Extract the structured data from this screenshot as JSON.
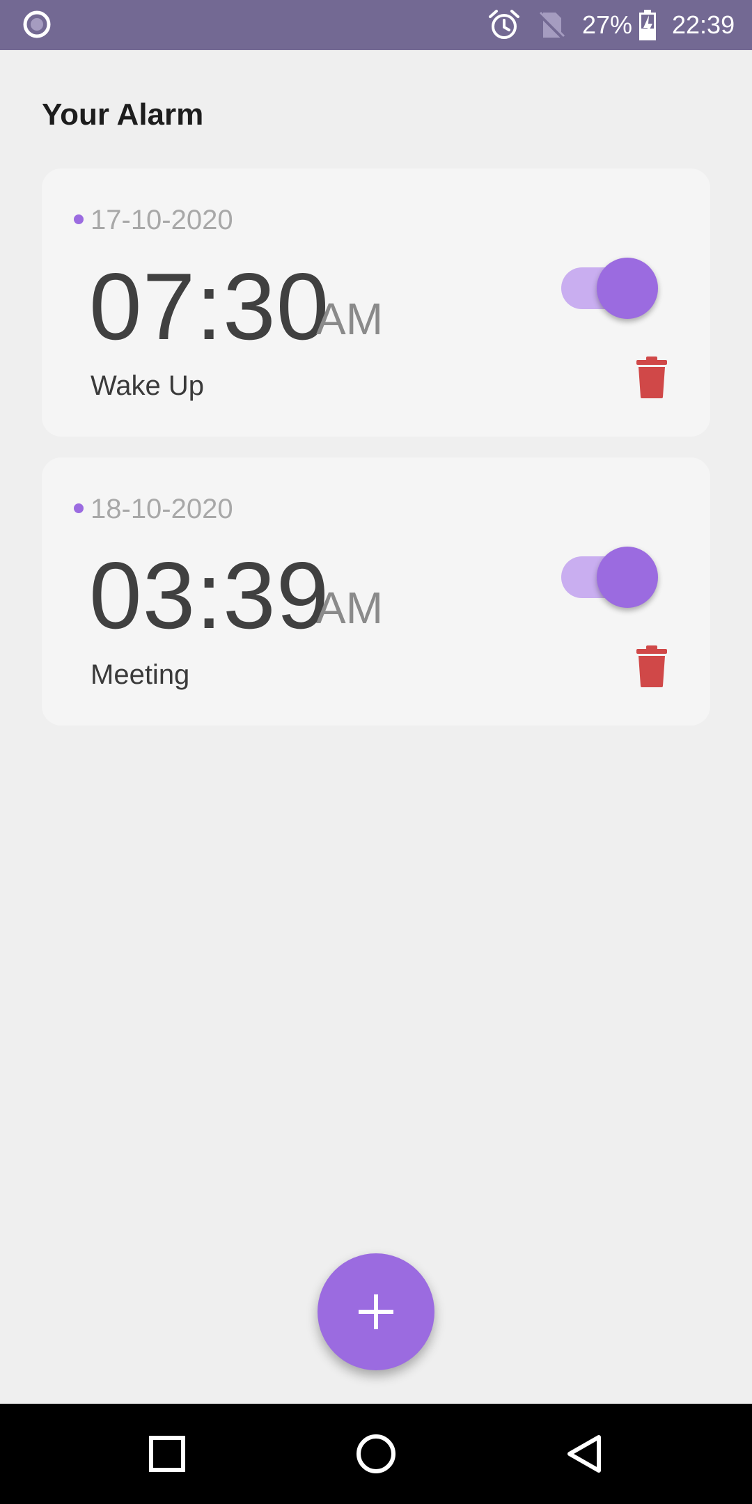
{
  "status_bar": {
    "battery": "27%",
    "time": "22:39",
    "background_color": "#736993"
  },
  "header": {
    "title": "Your Alarm"
  },
  "alarms": [
    {
      "date": "17-10-2020",
      "time": "07:30",
      "period": "AM",
      "label": "Wake Up",
      "enabled": true
    },
    {
      "date": "18-10-2020",
      "time": "03:39",
      "period": "AM",
      "label": "Meeting",
      "enabled": true
    }
  ],
  "fab": {
    "icon": "plus-icon"
  },
  "navigation": {
    "buttons": [
      "recents-icon",
      "home-icon",
      "back-icon"
    ]
  },
  "colors": {
    "accent": "#9b6be0",
    "accent_light": "#c9aef0",
    "delete": "#d04848",
    "background": "#efefef",
    "card": "#f5f5f5"
  }
}
